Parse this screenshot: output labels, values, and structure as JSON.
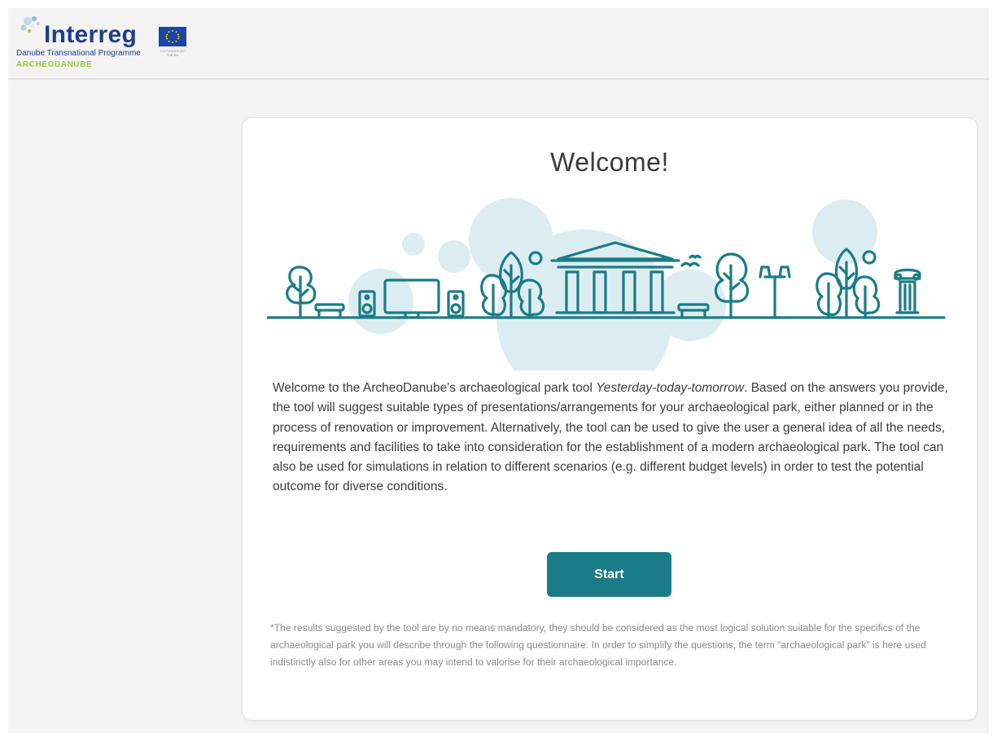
{
  "header": {
    "logo": {
      "name": "Interreg",
      "programme": "Danube Transnational Programme",
      "project": "ARCHEODANUBE",
      "eu_caption": "CO-FUNDED BY THE EU",
      "brand_color": "#1f3f8a",
      "accent_color": "#9cc73b"
    }
  },
  "main": {
    "title": "Welcome!",
    "illustration_icons": [
      "tree-icon",
      "bench-icon",
      "speaker-icon",
      "tv-icon",
      "temple-icon",
      "birds-icon",
      "street-lamp-icon",
      "column-capital-icon"
    ],
    "intro_before": "Welcome to the ArcheoDanube's archaeological park tool ",
    "intro_italic": "Yesterday-today-tomorrow",
    "intro_after": ". Based on the answers you provide, the tool will suggest suitable types of presentations/arrangements for your archaeological park, either planned or in the process of renovation or improvement. Alternatively, the tool can be used to give the user a general idea of all the needs, requirements and facilities to take into consideration for the establishment of a modern archaeological park. The tool can also be used for simulations in relation to different scenarios (e.g. different budget levels) in order to test the potential outcome for diverse conditions.",
    "start_label": "Start",
    "disclaimer": "*The results suggested by the tool are by no means mandatory, they should be considered as the most logical solution suitable for the specifics of the archaeological park you will describe through the following questionnaire. In order to simplify the questions, the term \"archaeological park\" is here used indistinctly also for other areas you may intend to valorise for their archaeological importance."
  },
  "colors": {
    "accent": "#1a7c86",
    "illustration_line": "#1a7c86",
    "illustration_bubbles": "#d6ebef"
  }
}
